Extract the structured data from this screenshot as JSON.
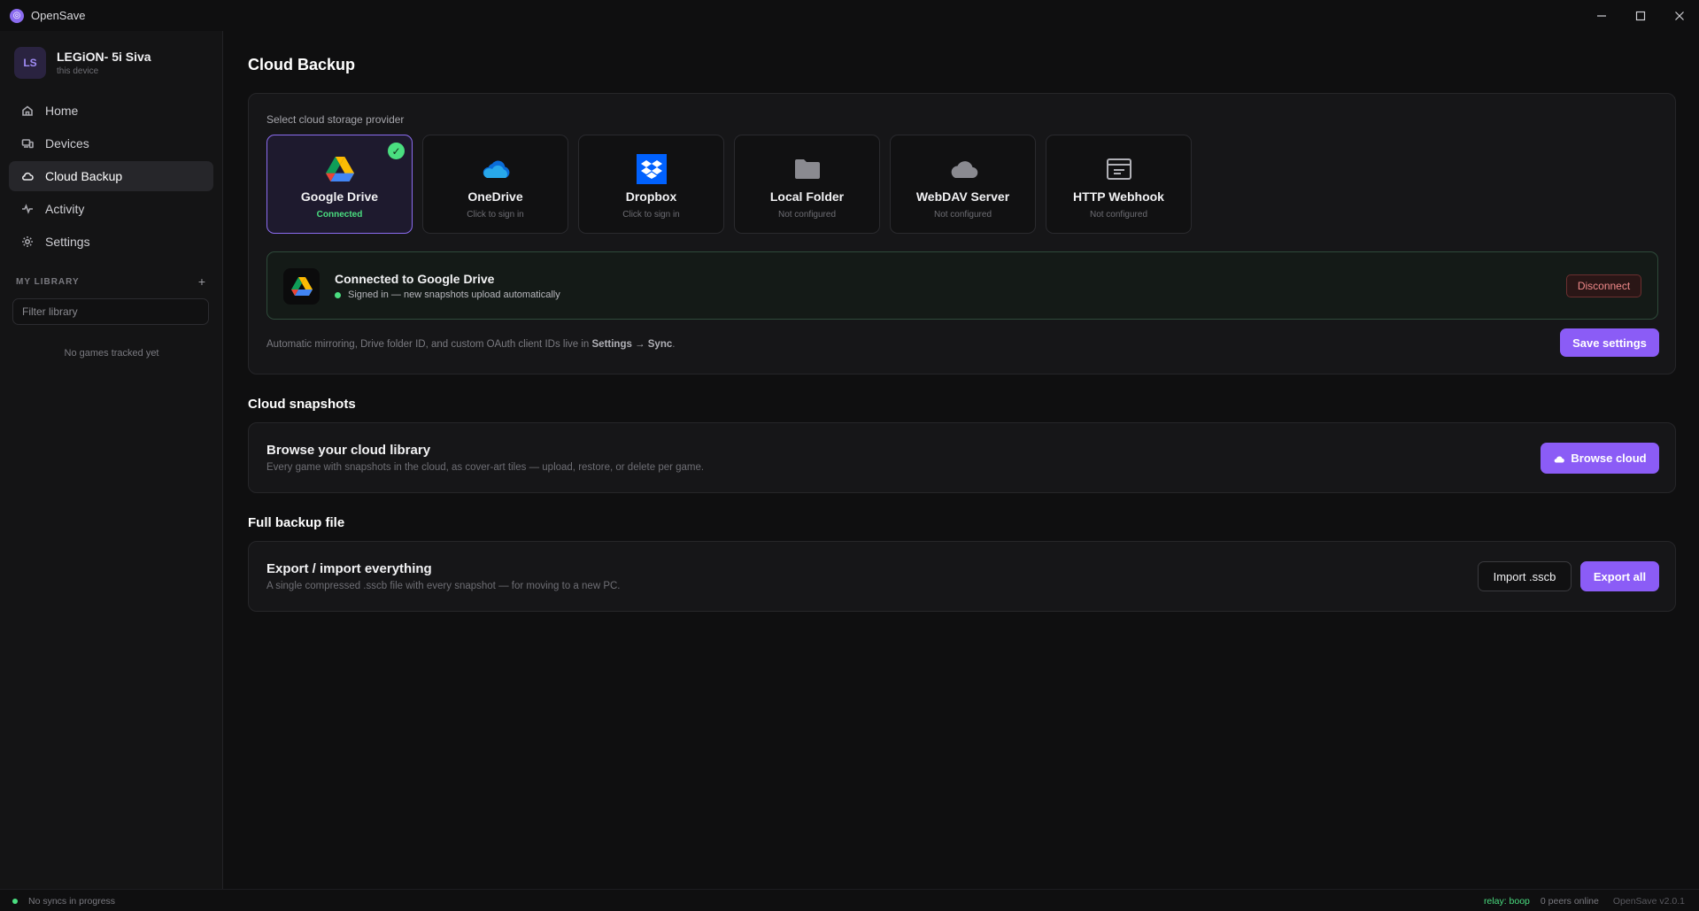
{
  "app": {
    "title": "OpenSave",
    "logo_icon": "opensave-logo-icon"
  },
  "window_controls": {
    "minimize": "minimize-icon",
    "maximize": "maximize-icon",
    "close": "close-icon"
  },
  "sidebar": {
    "device": {
      "initials": "LS",
      "name": "LEGiON- 5i Siva",
      "subtitle": "this device"
    },
    "nav": [
      {
        "label": "Home",
        "icon": "home-icon"
      },
      {
        "label": "Devices",
        "icon": "devices-icon"
      },
      {
        "label": "Cloud Backup",
        "icon": "cloud-icon",
        "active": true
      },
      {
        "label": "Activity",
        "icon": "activity-icon"
      },
      {
        "label": "Settings",
        "icon": "gear-icon"
      }
    ],
    "library": {
      "header": "MY LIBRARY",
      "add": "+",
      "filter_placeholder": "Filter library",
      "empty": "No games tracked yet"
    }
  },
  "main": {
    "title": "Cloud Backup",
    "provider_label": "Select cloud storage provider",
    "providers": [
      {
        "name": "Google Drive",
        "status": "Connected",
        "icon": "google-drive-icon",
        "selected": true,
        "check": "✓"
      },
      {
        "name": "OneDrive",
        "status": "Click to sign in",
        "icon": "onedrive-icon"
      },
      {
        "name": "Dropbox",
        "status": "Click to sign in",
        "icon": "dropbox-icon"
      },
      {
        "name": "Local Folder",
        "status": "Not configured",
        "icon": "folder-icon"
      },
      {
        "name": "WebDAV Server",
        "status": "Not configured",
        "icon": "cloud-server-icon"
      },
      {
        "name": "HTTP Webhook",
        "status": "Not configured",
        "icon": "webhook-icon"
      }
    ],
    "connection": {
      "title": "Connected to Google Drive",
      "subtitle": "Signed in — new snapshots upload automatically",
      "disconnect_label": "Disconnect"
    },
    "hint": {
      "prefix": "Automatic mirroring, Drive folder ID, and custom OAuth client IDs live in ",
      "bold": "Settings → Sync",
      "suffix": "."
    },
    "save_label": "Save settings",
    "snapshots": {
      "section_title": "Cloud snapshots",
      "title": "Browse your cloud library",
      "subtitle": "Every game with snapshots in the cloud, as cover-art tiles — upload, restore, or delete per game.",
      "browse_label": "Browse cloud"
    },
    "backup": {
      "section_title": "Full backup file",
      "title": "Export / import everything",
      "subtitle": "A single compressed .sscb file with every snapshot — for moving to a new PC.",
      "import_label": "Import .sscb",
      "export_label": "Export all"
    }
  },
  "statusbar": {
    "sync_status": "No syncs in progress",
    "relay": "relay: boop",
    "peers": "0 peers online",
    "version": "OpenSave v2.0.1"
  },
  "colors": {
    "accent": "#8b5cf6",
    "success": "#4ade80",
    "danger": "#f08a8a",
    "background": "#0f0f10"
  }
}
